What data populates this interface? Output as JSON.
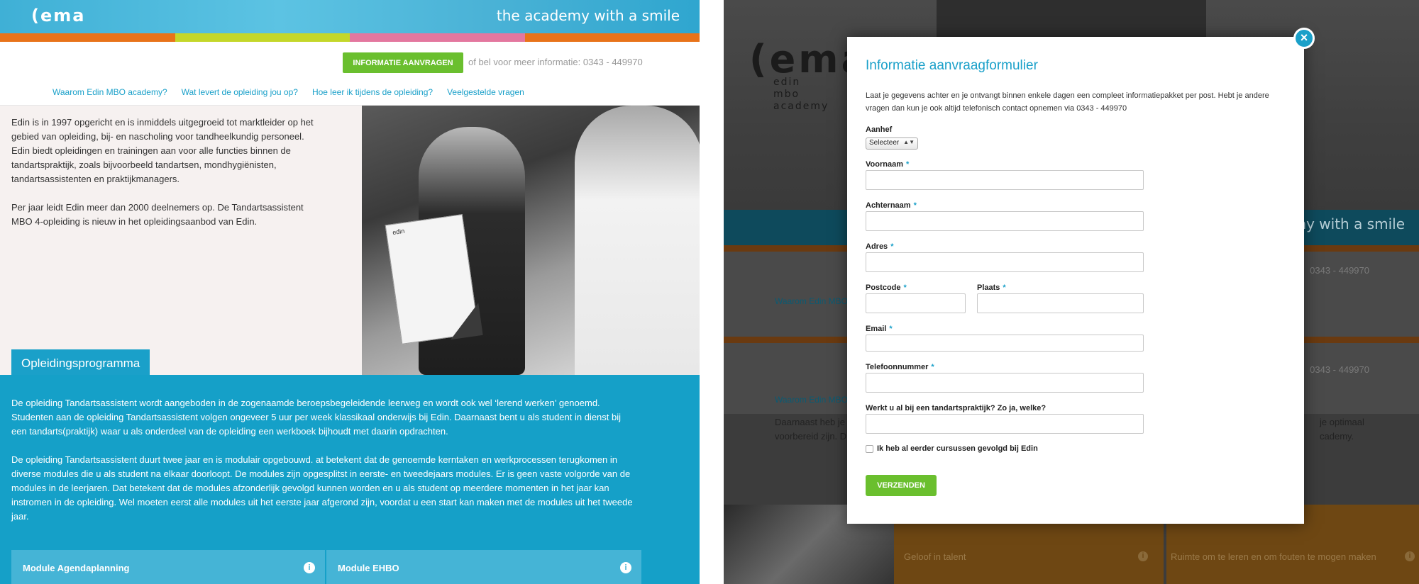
{
  "brand": {
    "logo": "(ema",
    "tagline": "the academy with a smile",
    "logo_dark": "(ema",
    "logo_sub": "edin\nmbo\nacademy",
    "stripe_colors": [
      "#e8731a",
      "#c4d72a",
      "#e3779f",
      "#e8731a"
    ]
  },
  "topbar": {
    "cta_label": "INFORMATIE AANVRAGEN",
    "cta_text": "of bel voor meer informatie: 0343 - 449970"
  },
  "nav": {
    "items": [
      "Waarom Edin MBO academy?",
      "Wat levert de opleiding jou op?",
      "Hoe leer ik tijdens de opleiding?",
      "Veelgestelde vragen"
    ]
  },
  "intro": {
    "p1": "Edin is in 1997 opgericht en is inmiddels uitgegroeid tot marktleider op het gebied van opleiding, bij- en nascholing voor tandheelkundig personeel. Edin biedt opleidingen en trainingen aan voor alle functies binnen de tandartspraktijk, zoals bijvoorbeeld tandartsen, mondhygiënisten, tandartsassistenten en praktijkmanagers.",
    "p2": "Per jaar leidt Edin meer dan 2000 deelnemers op. De Tandartsassistent MBO 4-opleiding is nieuw in het opleidingsaanbod van Edin."
  },
  "photo": {
    "cert_label": "edin"
  },
  "program": {
    "tab_label": "Opleidingsprogramma",
    "p1": "De opleiding Tandartsassistent wordt aangeboden in de zogenaamde beroepsbegeleidende leerweg en wordt ook wel ‘lerend werken’ genoemd. Studenten aan de opleiding Tandartsassistent volgen ongeveer 5 uur per week klassikaal onderwijs bij Edin. Daarnaast bent u als student in dienst bij een tandarts(praktijk) waar u als onderdeel van de opleiding een werkboek bijhoudt met daarin opdrachten.",
    "p2": "De opleiding Tandartsassistent duurt twee jaar en is modulair opgebouwd. at betekent dat de genoemde kerntaken en werkprocessen terugkomen in diverse modules die u als student na elkaar doorloopt. De modules zijn opgesplitst in eerste- en tweedejaars modules. Er is geen vaste volgorde van de modules in de leerjaren. Dat betekent dat de modules afzonderlijk gevolgd kunnen worden en u als student op meerdere momenten in het jaar kan instromen in de opleiding. Wel moeten eerst alle modules uit het eerste jaar afgerond zijn, voordat u een start kan maken met de modules uit het tweede jaar.",
    "modules": [
      {
        "label": "Module Agendaplanning",
        "info": "i"
      },
      {
        "label": "Module EHBO",
        "info": "i"
      }
    ]
  },
  "background_page": {
    "tagline": "emy with a smile",
    "phone1": "0343 - 449970",
    "phone2": "0343 - 449970",
    "nav1": "Waarom Edin MBO",
    "nav2": "Waarom Edin MBO",
    "text_left": "Daarnaast heb je p\nvoorbereid zijn. D",
    "text_right": "je optimaal\ncademy.",
    "org_items": [
      "Geloof in talent",
      "Ruimte om te leren en om fouten te mogen maken"
    ],
    "info": "i"
  },
  "modal": {
    "close": "×",
    "title": "Informatie aanvraagformulier",
    "description": "Laat je gegevens achter en je ontvangt binnen enkele dagen een compleet informatiepakket per post. Hebt je andere vragen dan kun je ook altijd telefonisch contact opnemen via 0343 - 449970",
    "salutation_label": "Aanhef",
    "salutation_value": "Selecteer",
    "caret": "▲▼",
    "required_mark": "*",
    "fields": {
      "first_name": "Voornaam",
      "last_name": "Achternaam",
      "address": "Adres",
      "postcode": "Postcode",
      "city": "Plaats",
      "email": "Email",
      "phone": "Telefoonnummer",
      "practice": "Werkt u al bij een tandartspraktijk? Zo ja, welke?"
    },
    "checkbox_label": "Ik heb al eerder cursussen gevolgd bij Edin",
    "submit_label": "VERZENDEN"
  }
}
